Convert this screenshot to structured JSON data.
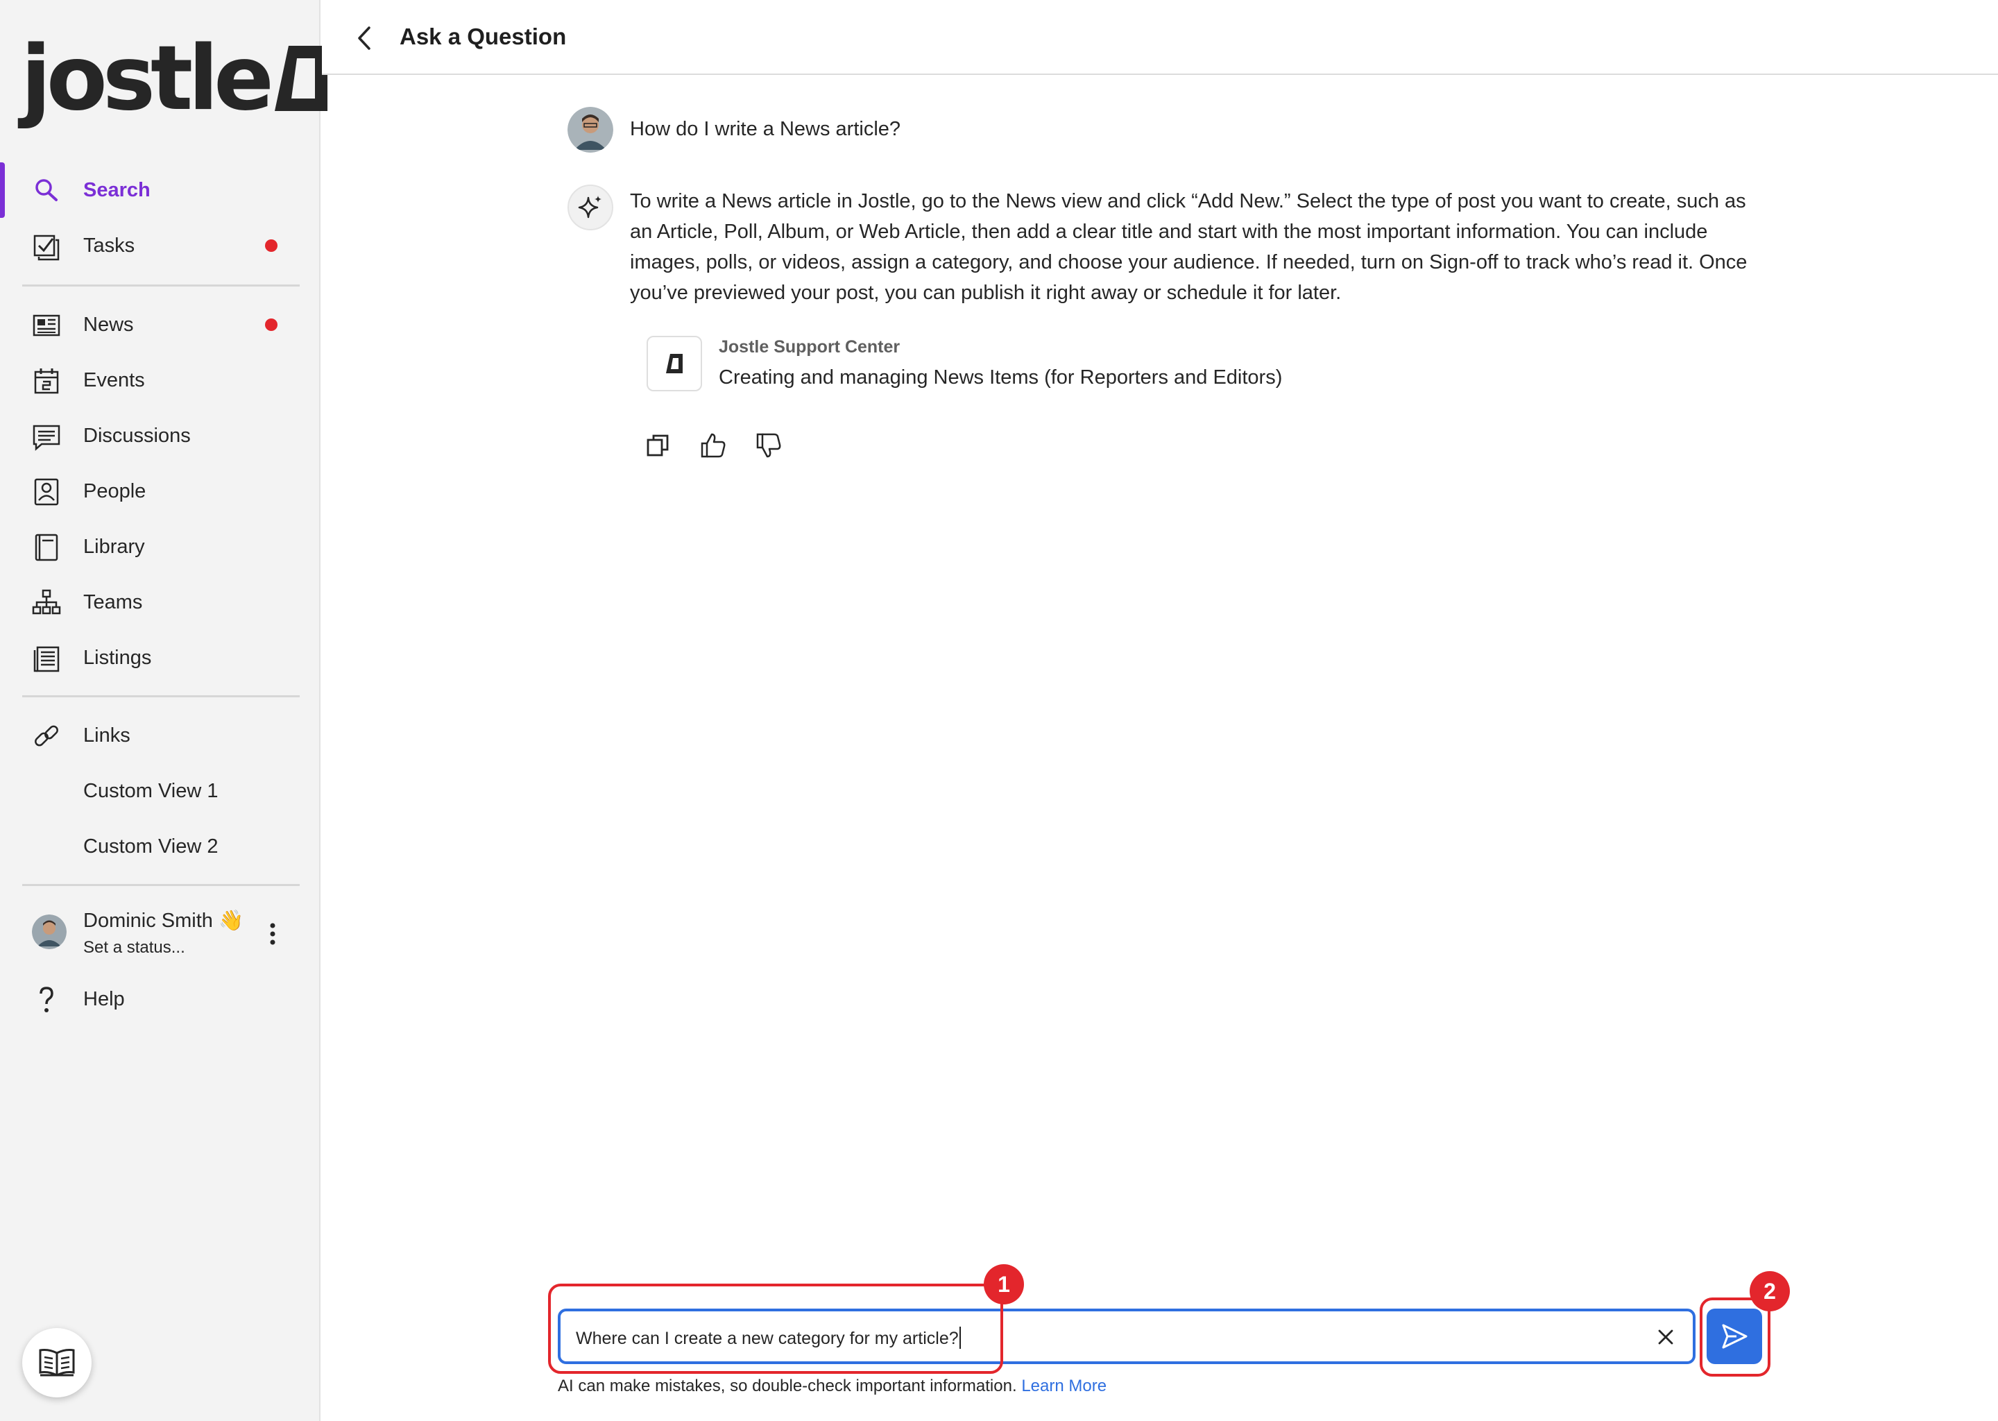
{
  "brand": {
    "logo_text": "jostle"
  },
  "sidebar": {
    "search": {
      "label": "Search",
      "icon": "search-icon"
    },
    "tasks": {
      "label": "Tasks",
      "icon": "tasks-icon"
    },
    "news": {
      "label": "News",
      "icon": "news-icon"
    },
    "events": {
      "label": "Events",
      "icon": "calendar-icon"
    },
    "discussions": {
      "label": "Discussions",
      "icon": "discussions-icon"
    },
    "people": {
      "label": "People",
      "icon": "people-icon"
    },
    "library": {
      "label": "Library",
      "icon": "library-icon"
    },
    "teams": {
      "label": "Teams",
      "icon": "teams-icon"
    },
    "listings": {
      "label": "Listings",
      "icon": "listings-icon"
    },
    "links": {
      "label": "Links",
      "icon": "link-icon"
    },
    "custom1": {
      "label": "Custom View 1"
    },
    "custom2": {
      "label": "Custom View 2"
    },
    "help": {
      "label": "Help",
      "icon": "help-icon"
    },
    "accent_color": "#7b2fd6",
    "notification_color": "#e3262c"
  },
  "user": {
    "name": "Dominic Smith",
    "emoji": "👋",
    "status": "Set a status..."
  },
  "header": {
    "title": "Ask a Question"
  },
  "conversation": {
    "question": "How do I write a News article?",
    "answer": "To write a News article in Jostle, go to the News view and click “Add New.” Select the type of post you want to create, such as an Article, Poll, Album, or Web Article, then add a clear title and start with the most important information. You can include images, polls, or videos, assign a category, and choose your audience. If needed, turn on Sign-off to track who’s read it. Once you’ve previewed your post, you can publish it right away or schedule it for later.",
    "source": {
      "name": "Jostle Support Center",
      "title": "Creating and managing News Items (for Reporters and Editors)"
    }
  },
  "composer": {
    "value": "Where can I create a new category for my article?",
    "disclaimer": "AI can make mistakes, so double-check important information.",
    "learn_more": "Learn More",
    "accent_color": "#2f6fe0"
  },
  "callouts": {
    "one": "1",
    "two": "2",
    "color": "#e3262c"
  }
}
